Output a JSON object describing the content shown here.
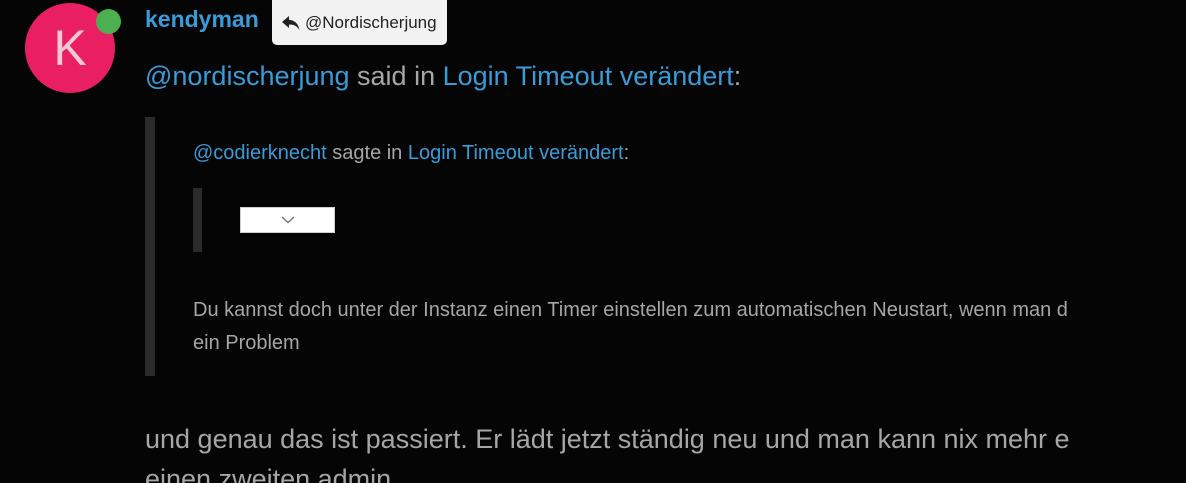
{
  "post": {
    "avatar_letter": "K",
    "username": "kendyman",
    "reply_to": "@Nordischerjung",
    "said_line": {
      "mention": "@nordischerjung",
      "said_in": " said in ",
      "topic": "Login Timeout verändert",
      "colon": ":"
    },
    "quote": {
      "inner_said": {
        "mention": "@codierknecht",
        "said_in": " sagte in ",
        "topic": "Login Timeout verändert",
        "colon": ":"
      },
      "body_lines": [
        "Du kannst doch unter der Instanz einen Timer einstellen zum automatischen Neustart, wenn man d",
        "ein Problem"
      ]
    },
    "body_lines": [
      "und genau das ist passiert. Er lädt jetzt ständig neu und man kann nix mehr e",
      "einen zweiten admin."
    ]
  },
  "colors": {
    "background": "#050505",
    "avatar": "#e91e63",
    "online": "#4caf50",
    "link": "#3a9bd9",
    "text": "#a6a6a6",
    "quote_bar": "#2b2b2b"
  },
  "icons": {
    "reply": "reply-arrow-icon",
    "expand": "chevron-down-icon",
    "status": "online-status-icon"
  }
}
